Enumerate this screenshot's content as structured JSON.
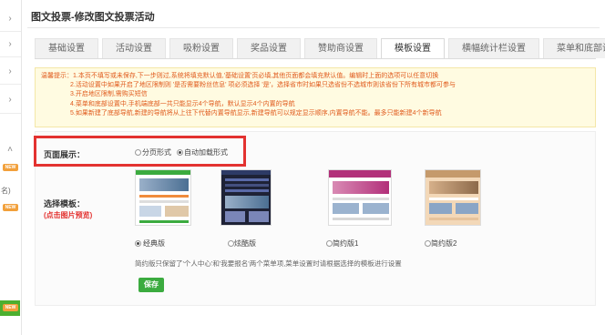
{
  "header": {
    "title": "图文投票-修改图文投票活动"
  },
  "tabs": [
    {
      "label": "基础设置"
    },
    {
      "label": "活动设置"
    },
    {
      "label": "吸粉设置"
    },
    {
      "label": "奖品设置"
    },
    {
      "label": "赞助商设置"
    },
    {
      "label": "模板设置",
      "active": true
    },
    {
      "label": "横幅统计栏设置"
    },
    {
      "label": "菜单和底部设置"
    }
  ],
  "tips": {
    "prefix": "温馨提示：",
    "lines": [
      "1.本页不填写或未保存,下一步则过,系统将填充默认值,'基础设置'页必填,其他页面都会填充默认值。编辑时上面的选项可以任意切换",
      "2.活动设置中如果开启了地区限制则 '是否需要粉丝信息' 项必须选择 '是'，选择省市时如果只选省份不选城市则该省份下所有城市都可参与",
      "3.开启地区限制,需购买短信",
      "4.菜单和底部设置中,手机端底部一共只能显示4个导航，默认显示4个内置的导航",
      "5.如果新建了底部导航,新建的导航将从上往下代替内置导航显示,新建导航可以规定显示顺序,内置导航不能。最多只能新建4个新导航"
    ]
  },
  "page_display": {
    "label": "页面展示：",
    "options": [
      {
        "label": "分页形式",
        "selected": false
      },
      {
        "label": "自动加载形式",
        "selected": true
      }
    ]
  },
  "template": {
    "label": "选择模板：",
    "hint": "(点击图片预览)",
    "options": [
      {
        "label": "经典版",
        "selected": true
      },
      {
        "label": "炫酷版",
        "selected": false
      },
      {
        "label": "简约版1",
        "selected": false
      },
      {
        "label": "简约版2",
        "selected": false
      }
    ],
    "note": "简约版只保留了'个人中心'和'我要报名'两个菜单项,菜单设置时请根据选择的模板进行设置"
  },
  "actions": {
    "save_label": "保存"
  },
  "sidebar": {
    "badges": [
      "NEW",
      "NEW",
      "NEW"
    ],
    "fragment": "名)"
  },
  "colors": {
    "accent_green": "#3bab3f",
    "highlight_red": "#e33230",
    "tips_text": "#e05a1c",
    "tips_bg": "#fffbe1"
  }
}
